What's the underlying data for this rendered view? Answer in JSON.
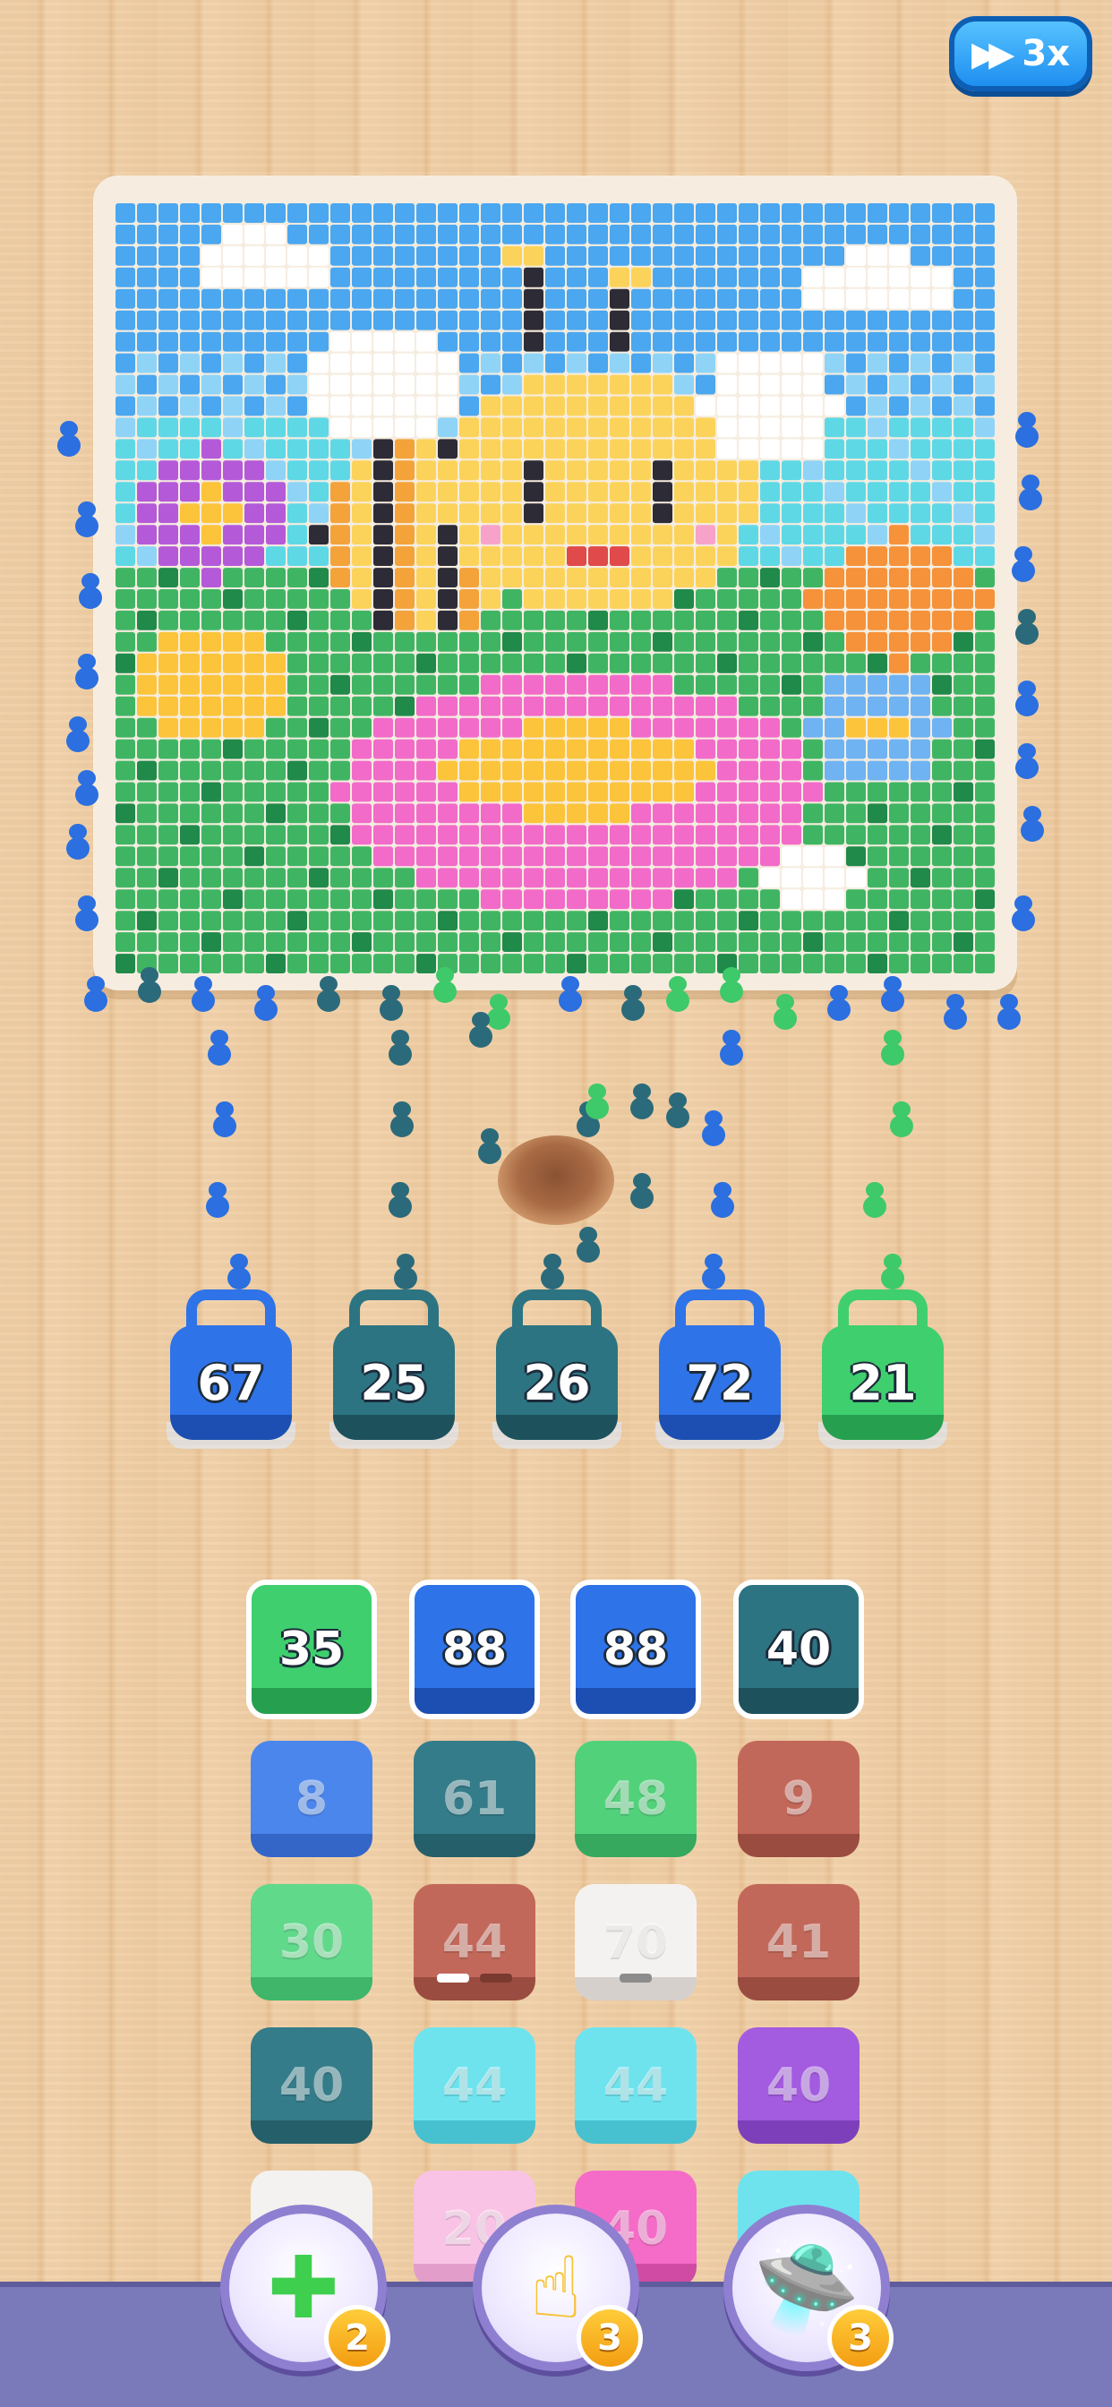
{
  "speed": {
    "label": "3x",
    "icon": "fast-forward-icon"
  },
  "picture": {
    "subject": "bee",
    "colors": {
      "sky": "#4aa7f0",
      "sky_light": "#8fd4f7",
      "cloud": "#ffffff",
      "bee_yellow": "#fcd35a",
      "bee_black": "#2d2b35",
      "wing": "#ffffff",
      "flower_pink": "#f26bc9",
      "flower_center": "#fbc43b",
      "orange_flower": "#f5923a",
      "purple_flower": "#b45ad9",
      "grass": "#3fb563",
      "grass_dark": "#1f8a4a",
      "cyan": "#5fd8e6",
      "blue_flower": "#6fb3f2"
    }
  },
  "collectors": [
    {
      "value": "67",
      "color": "#2f73e8",
      "dark": "#1d4fb3"
    },
    {
      "value": "25",
      "color": "#2d7482",
      "dark": "#1d525c"
    },
    {
      "value": "26",
      "color": "#2d7482",
      "dark": "#1d525c"
    },
    {
      "value": "72",
      "color": "#2f73e8",
      "dark": "#1d4fb3"
    },
    {
      "value": "21",
      "color": "#3fcf6e",
      "dark": "#26a04f"
    }
  ],
  "tiles": [
    [
      {
        "value": "35",
        "color": "#3fcf6e",
        "dark": "#26a04f",
        "active": true
      },
      {
        "value": "88",
        "color": "#2f73e8",
        "dark": "#1d4fb3",
        "active": true
      },
      {
        "value": "88",
        "color": "#2f73e8",
        "dark": "#1d4fb3",
        "active": true
      },
      {
        "value": "40",
        "color": "#2d7482",
        "dark": "#1d525c",
        "active": true
      }
    ],
    [
      {
        "value": "8",
        "color": "#4b86ec",
        "dark": "#3466c7",
        "active": false
      },
      {
        "value": "61",
        "color": "#347c89",
        "dark": "#255f69",
        "active": false
      },
      {
        "value": "48",
        "color": "#52d17b",
        "dark": "#36a95e",
        "active": false
      },
      {
        "value": "9",
        "color": "#c2685a",
        "dark": "#9b4c40",
        "active": false
      }
    ],
    [
      {
        "value": "30",
        "color": "#60d98a",
        "dark": "#3fb66a",
        "active": false
      },
      {
        "value": "44",
        "color": "#c2685a",
        "dark": "#9b4c40",
        "active": false,
        "bars": [
          "#ffffff",
          "#7a3a30"
        ]
      },
      {
        "value": "70",
        "color": "#f4f2f0",
        "dark": "#d5d0cc",
        "active": false,
        "bars": [
          "#8c8c8c"
        ]
      },
      {
        "value": "41",
        "color": "#c2685a",
        "dark": "#9b4c40",
        "active": false
      }
    ],
    [
      {
        "value": "40",
        "color": "#347c89",
        "dark": "#255f69",
        "active": false
      },
      {
        "value": "44",
        "color": "#6ee3ee",
        "dark": "#47c1cf",
        "active": false
      },
      {
        "value": "44",
        "color": "#6ee3ee",
        "dark": "#47c1cf",
        "active": false
      },
      {
        "value": "40",
        "color": "#a35be0",
        "dark": "#7e3fbb",
        "active": false
      }
    ],
    [
      {
        "value": "",
        "color": "#f4f2f0",
        "dark": "#d5d0cc",
        "active": false
      },
      {
        "value": "20",
        "color": "#f9c3e6",
        "dark": "#e39dca",
        "active": false
      },
      {
        "value": "40",
        "color": "#f46cc7",
        "dark": "#d04ba3",
        "active": false
      },
      {
        "value": "",
        "color": "#6ee3ee",
        "dark": "#47c1cf",
        "active": false
      }
    ]
  ],
  "boosters": [
    {
      "name": "add-slot-booster",
      "icon": "plus-icon",
      "count": "2"
    },
    {
      "name": "hand-booster",
      "icon": "hand-icon",
      "count": "3"
    },
    {
      "name": "ufo-booster",
      "icon": "ufo-icon",
      "count": "3"
    }
  ]
}
